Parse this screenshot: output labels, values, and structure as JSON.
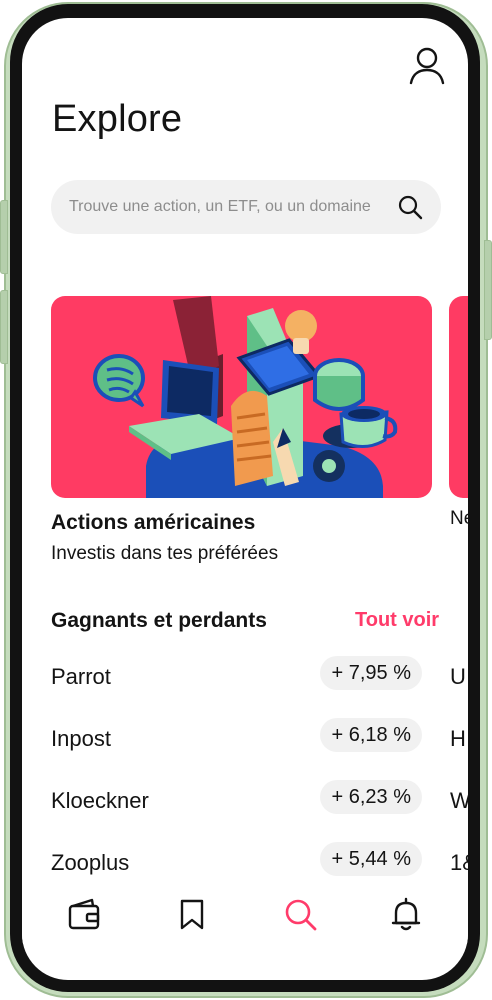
{
  "header": {
    "title": "Explore"
  },
  "search": {
    "placeholder": "Trouve une action, un ETF, ou un domaine",
    "value": ""
  },
  "featured": {
    "title": "Actions américaines",
    "subtitle": "Investis dans tes préférées",
    "next_card_title": "Ne"
  },
  "movers": {
    "section_title": "Gagnants et perdants",
    "see_all_label": "Tout voir",
    "rows": [
      {
        "name": "Parrot",
        "change": "+ 7,95 %",
        "next_col": "U"
      },
      {
        "name": "Inpost",
        "change": "+ 6,18 %",
        "next_col": "H"
      },
      {
        "name": "Kloeckner",
        "change": "+ 6,23 %",
        "next_col": "W"
      },
      {
        "name": "Zooplus",
        "change": "+ 5,44 %",
        "next_col": "1&"
      }
    ]
  },
  "nav": {
    "items": [
      {
        "icon": "wallet-icon",
        "active": false
      },
      {
        "icon": "bookmark-icon",
        "active": false
      },
      {
        "icon": "search-icon",
        "active": true
      },
      {
        "icon": "bell-icon",
        "active": false
      }
    ]
  },
  "colors": {
    "accent": "#ff3b6a",
    "card_bg": "#ff3b63",
    "badge_bg": "#f1f1f1",
    "frame": "#c5dcbd",
    "text": "#141414"
  }
}
